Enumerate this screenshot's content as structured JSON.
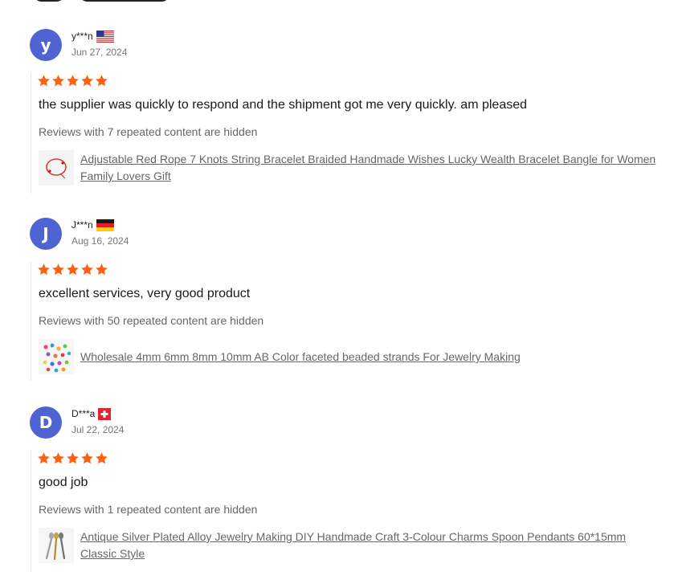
{
  "reviews": [
    {
      "avatar_letter": "y",
      "username": "y***n",
      "country_flag": "us-flag",
      "date": "Jun 27, 2024",
      "rating": 5,
      "text": "the supplier was quickly to respond and the shipment got me very quickly. am pleased",
      "hidden_note": "Reviews with 7 repeated content are hidden",
      "product_title": "Adjustable Red Rope 7 Knots String Bracelet Braided Handmade Wishes Lucky Wealth Bracelet Bangle for Women Family Lovers Gift",
      "product_thumb": "red-bracelet-thumbnail"
    },
    {
      "avatar_letter": "J",
      "username": "J***n",
      "country_flag": "de-flag",
      "date": "Aug 16, 2024",
      "rating": 5,
      "text": "excellent services, very good product",
      "hidden_note": "Reviews with 50 repeated content are hidden",
      "product_title": "Wholesale 4mm 6mm 8mm 10mm AB Color faceted beaded strands For Jewelry Making",
      "product_thumb": "beads-thumbnail"
    },
    {
      "avatar_letter": "D",
      "username": "D***a",
      "country_flag": "ch-flag",
      "date": "Jul 22, 2024",
      "rating": 5,
      "text": "good job",
      "hidden_note": "Reviews with 1 repeated content are hidden",
      "product_title": "Antique Silver Plated Alloy Jewelry Making DIY Handmade Craft 3-Colour Charms Spoon Pendants 60*15mm Classic Style",
      "product_thumb": "spoon-charms-thumbnail"
    }
  ],
  "colors": {
    "avatar": "#4f63d2",
    "star": "#fd6110",
    "link": "#666666"
  }
}
